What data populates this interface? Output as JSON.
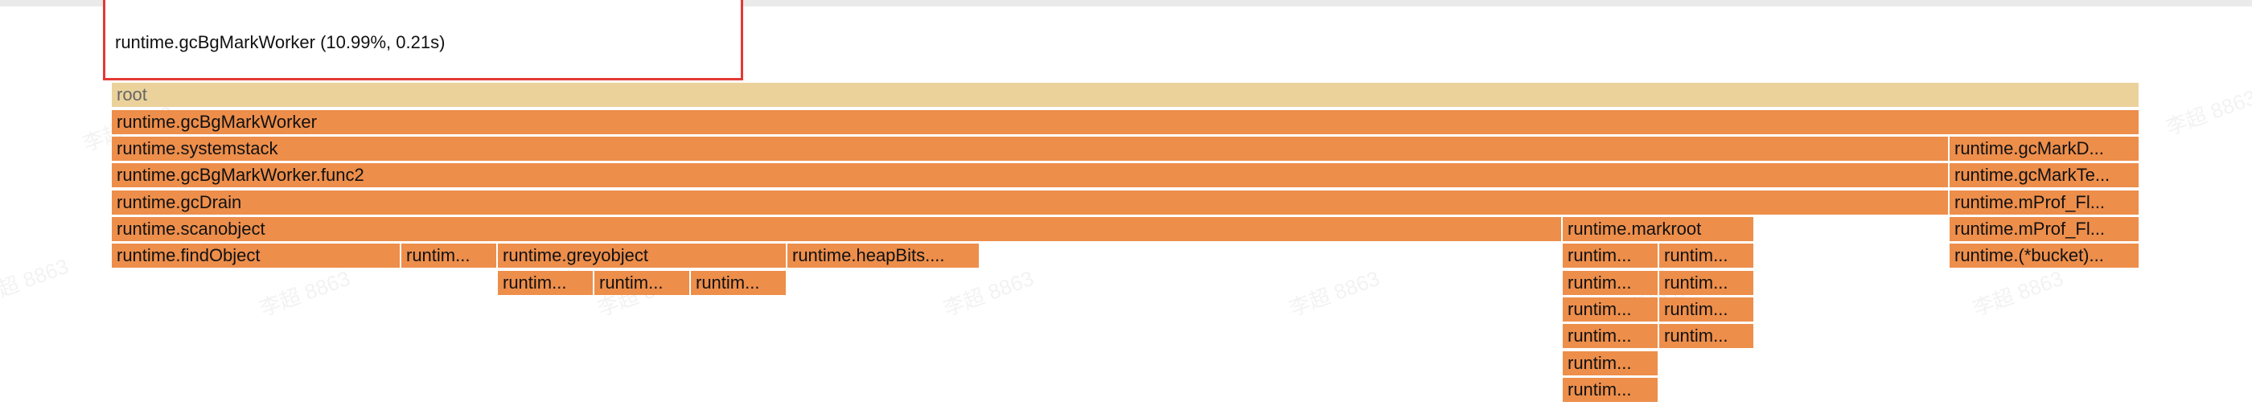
{
  "tooltip": {
    "text": "runtime.gcBgMarkWorker (10.99%, 0.21s)"
  },
  "watermark": {
    "text": "李超 8863"
  },
  "frames": {
    "root": "root",
    "gcBgMarkWorker": "runtime.gcBgMarkWorker",
    "systemstack": "runtime.systemstack",
    "gcBgMarkWorker_func2": "runtime.gcBgMarkWorker.func2",
    "gcDrain": "runtime.gcDrain",
    "scanobject": "runtime.scanobject",
    "findObject": "runtime.findObject",
    "runtim_a": "runtim...",
    "greyobject": "runtime.greyobject",
    "heapBits": "runtime.heapBits....",
    "runtim_b": "runtim...",
    "runtim_c": "runtim...",
    "runtim_d": "runtim...",
    "markroot": "runtime.markroot",
    "mr_l1": "runtim...",
    "mr_l2": "runtim...",
    "mr_l3": "runtim...",
    "mr_l4": "runtim...",
    "mr_l5": "runtim...",
    "mr_l6": "runtim...",
    "mr_r1": "runtim...",
    "mr_r2": "runtim...",
    "mr_r3": "runtim...",
    "mr_r4": "runtim...",
    "gcMarkD": "runtime.gcMarkD...",
    "gcMarkTe": "runtime.gcMarkTe...",
    "mProf_Fl1": "runtime.mProf_Fl...",
    "mProf_Fl2": "runtime.mProf_Fl...",
    "bucket": "runtime.(*bucket)..."
  }
}
